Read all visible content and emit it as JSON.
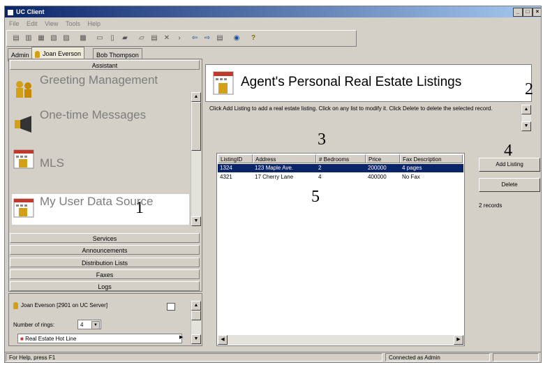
{
  "window": {
    "title": "UC Client"
  },
  "menu": [
    "File",
    "Edit",
    "View",
    "Tools",
    "Help"
  ],
  "tabs": [
    "Admin",
    "Joan Everson",
    "Bob Thompson"
  ],
  "left": {
    "assistant_header": "Assistant",
    "items": [
      {
        "label": "Greeting Management",
        "icon": "greeting-icon"
      },
      {
        "label": "One-time Messages",
        "icon": "megaphone-icon"
      },
      {
        "label": "MLS",
        "icon": "calendar-building-icon"
      },
      {
        "label": "My User Data Source",
        "icon": "calendar-building-icon"
      }
    ],
    "sections": [
      "Services",
      "Announcements",
      "Distribution Lists",
      "Faxes",
      "Logs"
    ],
    "user_line": "Joan Everson [2901 on UC Server]",
    "rings_label": "Number of rings:",
    "rings_value": "4",
    "hotline": "Real Estate Hot Line"
  },
  "main": {
    "title": "Agent's Personal Real Estate Listings",
    "instructions": "Click Add Listing to add a real estate listing. Click on any list to modify it. Click Delete to delete the selected record.",
    "columns": [
      "ListingID",
      "Address",
      "# Bedrooms",
      "Price",
      "Fax Description"
    ],
    "rows": [
      [
        "1324",
        "123 Maple Ave.",
        "2",
        "200000",
        "4 pages"
      ],
      [
        "4321",
        "17 Cherry Lane",
        "4",
        "400000",
        "No Fax"
      ]
    ],
    "add_button": "Add Listing",
    "delete_button": "Delete",
    "record_count": "2 records"
  },
  "callouts": [
    "1",
    "2",
    "3",
    "4",
    "5"
  ],
  "status": {
    "help": "For Help, press F1",
    "connection": "Connected as Admin"
  },
  "colors": {
    "title_bar": "#0a246a",
    "selection": "#0a246a",
    "chrome": "#d4d0c8"
  }
}
